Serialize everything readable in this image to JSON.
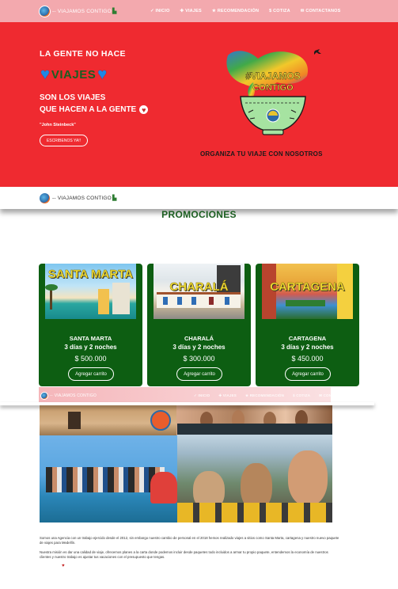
{
  "brand": {
    "name": "VIAJAMOS CONTIGO",
    "prefix": "--"
  },
  "nav": {
    "items": [
      {
        "label": "✓ INICIO",
        "icon": "check-icon"
      },
      {
        "label": "✚ VIAJES",
        "icon": "plus-icon"
      },
      {
        "label": "★ RECOMENDACIÓN",
        "icon": "star-icon"
      },
      {
        "label": "$ COTIZA",
        "icon": "dollar-icon"
      },
      {
        "label": "✉ CONTACTANOS",
        "icon": "mail-icon"
      }
    ]
  },
  "hero": {
    "title": "LA GENTE NO HACE",
    "highlight": "VIAJES",
    "sub1": "SON LOS VIAJES",
    "sub2": "QUE HACEN A LA GENTE",
    "quote": "\"John Steinbeck\"",
    "cta": "ESCRIBENOS YA!!",
    "art_text_1": "#VIAJAMOS",
    "art_text_2": "CONTIGO",
    "tagline": "ORGANIZA TU VIAJE CON NOSOTROS"
  },
  "promos": {
    "title": "PROMOCIONES",
    "cards": [
      {
        "img_label": "SANTA MARTA",
        "name": "SANTA MARTA",
        "duration": "3 días y 2 noches",
        "price": "$ 500.000",
        "button": "Agregar carrito"
      },
      {
        "img_label": "CHARALÁ",
        "name": "CHARALÁ",
        "duration": "3 días y 2 noches",
        "price": "$ 300.000",
        "button": "Agregar carrito"
      },
      {
        "img_label": "CARTAGENA",
        "name": "CARTAGENA",
        "duration": "3 días y 2 noches",
        "price": "$ 450.000",
        "button": "Agregar carrito"
      }
    ]
  },
  "about": {
    "p1": "Somos una Agencia con un trabajo ejercido desde el 2012, sin embargo nuestro cambio de personal en el 2018 hemos realizado viajes a sitios como Santa Marta, cartagena y nuestro nuevo paquete de viajes para Medellín.",
    "p2": "Nuestra misión es dar una calidad de viaje, ofrecemos planes a la carta donde podemos incluir desde paquetes todo incluidos a armar tu propio paquete, entendemos la economía de nuestros clientes y nuestro trabajo es ajustar tus vacaciones con el presupuesto que tengas."
  },
  "colors": {
    "navbar": "#f3a9ae",
    "hero_bg": "#ef2a30",
    "card_bg": "#0d5e12",
    "promo_title": "#1b5e20",
    "highlight_text": "#1b5e20",
    "heart": "#1e88e5"
  }
}
